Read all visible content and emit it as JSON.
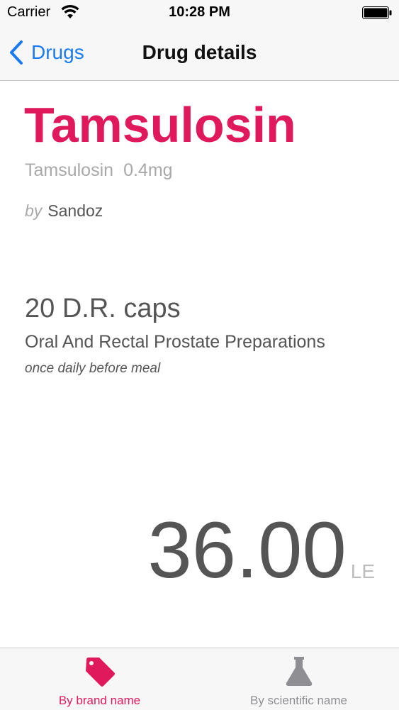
{
  "status_bar": {
    "carrier": "Carrier",
    "time": "10:28 PM"
  },
  "nav": {
    "back_label": "Drugs",
    "title": "Drug details"
  },
  "drug": {
    "brand_name": "Tamsulosin",
    "scientific_name": "Tamsulosin",
    "strength": "0.4mg",
    "by_label": "by",
    "manufacturer": "Sandoz",
    "pack": "20 D.R. caps",
    "category": "Oral And Rectal Prostate Preparations",
    "dosage": "once daily before meal",
    "price": "36.00",
    "currency": "LE"
  },
  "tabs": [
    {
      "label": "By brand name",
      "icon": "tag-icon",
      "active": true
    },
    {
      "label": "By scientific name",
      "icon": "flask-icon",
      "active": false
    }
  ],
  "colors": {
    "accent": "#e0195c",
    "link": "#1a7bf0",
    "inactive_tab": "#8e8e93"
  }
}
